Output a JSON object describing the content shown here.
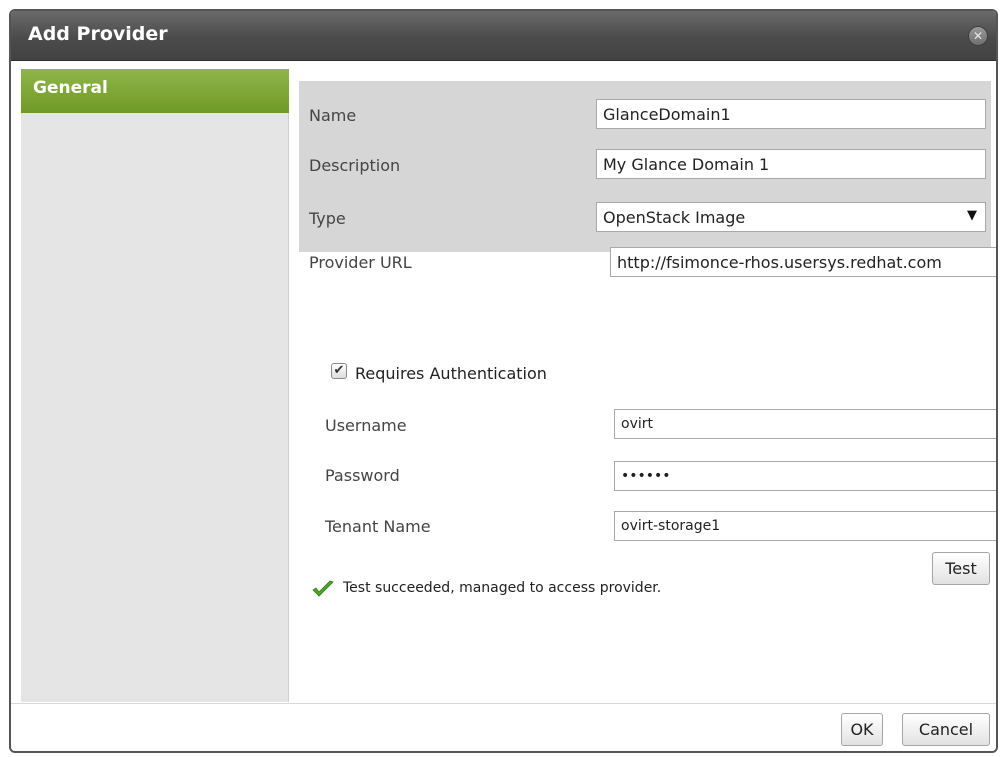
{
  "dialog": {
    "title": "Add Provider",
    "close_icon": "close-circle-icon"
  },
  "sidebar": {
    "items": [
      {
        "label": "General",
        "selected": true
      }
    ]
  },
  "form": {
    "name": {
      "label": "Name",
      "value": "GlanceDomain1"
    },
    "description": {
      "label": "Description",
      "value": "My Glance Domain 1"
    },
    "type": {
      "label": "Type",
      "value": "OpenStack Image"
    },
    "provider_url": {
      "label": "Provider URL",
      "value": "http://fsimonce-rhos.usersys.redhat.com"
    },
    "requires_auth": {
      "label": "Requires Authentication",
      "checked": true
    },
    "username": {
      "label": "Username",
      "value": "ovirt"
    },
    "password": {
      "label": "Password",
      "value": "••••••"
    },
    "tenant_name": {
      "label": "Tenant Name",
      "value": "ovirt-storage1"
    }
  },
  "test": {
    "status_icon": "checkmark-icon",
    "status_text": "Test succeeded, managed to access provider.",
    "button_label": "Test"
  },
  "footer": {
    "ok_label": "OK",
    "cancel_label": "Cancel"
  },
  "colors": {
    "accent_green": "#7ea83a",
    "titlebar": "#4b4b4b",
    "section_gray": "#d6d6d6"
  }
}
